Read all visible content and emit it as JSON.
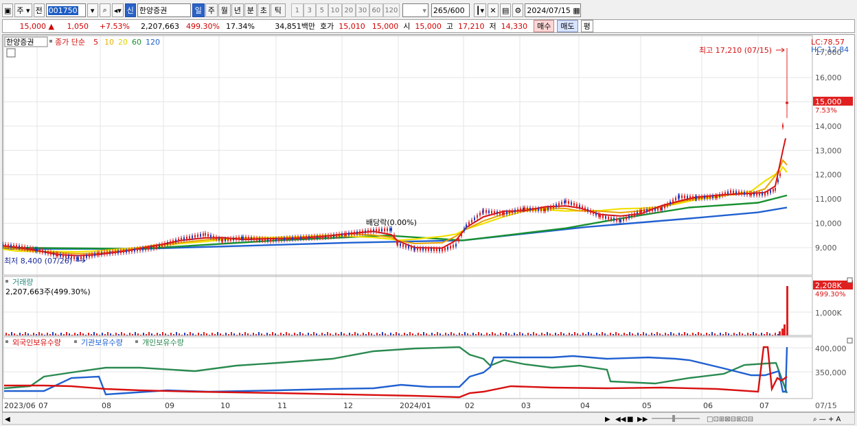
{
  "toolbar": {
    "market_type": "주",
    "prev_label": "전",
    "stock_code": "001750",
    "shin_badge": "신",
    "stock_name": "한양증권",
    "periods": [
      "일",
      "주",
      "월",
      "년",
      "분",
      "초",
      "틱"
    ],
    "active_period": "일",
    "numbers": [
      "1",
      "3",
      "5",
      "10",
      "20",
      "30",
      "60",
      "120"
    ],
    "count": "265",
    "count_max": "/600",
    "date": "2024/07/15"
  },
  "quote": {
    "price": "15,000",
    "change": "1,050",
    "change_pct": "+7.53%",
    "volume": "2,207,663",
    "volume_ratio": "499.30%",
    "turnover": "17.34%",
    "amount": "34,851백만",
    "hoga_label": "호가",
    "ask": "15,010",
    "bid": "15,000",
    "open_label": "시",
    "open": "15,000",
    "high_label": "고",
    "high": "17,210",
    "low_label": "저",
    "low": "14,330",
    "buy_label": "매수",
    "sell_label": "매도",
    "avg_label": "평"
  },
  "price_panel": {
    "stock_tag": "한양증권",
    "legend_title": "종가 단순",
    "ma_periods": [
      "5",
      "10",
      "20",
      "60",
      "120"
    ],
    "ma_colors": [
      "#d81010",
      "#e8b000",
      "#f0e000",
      "#189030",
      "#2060d0"
    ],
    "lc_label": "LC:78.57",
    "hc_label": "HC:-12.84",
    "high_annotation": "최고 17,210 (07/15)",
    "low_annotation": "최저 8,400 (07/26)",
    "dividend_annotation": "배당락(0.00%)",
    "price_tag": "15,000",
    "price_tag_pct": "7.53%",
    "y_ticks": [
      "16,000",
      "15,000",
      "14,000",
      "13,000",
      "12,000",
      "11,000",
      "10,000",
      "9,000"
    ],
    "top_tick_partial": "17,000"
  },
  "volume_panel": {
    "title": "거래량",
    "value_label": "2,207,663주(499.30%)",
    "tag": "2,208K",
    "tag_pct": "499.30%",
    "y_tick": "1,000K"
  },
  "holdings_panel": {
    "series_labels": [
      "외국인보유수량",
      "기관보유수량",
      "개인보유수량"
    ],
    "series_colors": [
      "#d81010",
      "#2060d0",
      "#2a8a50"
    ],
    "y_ticks": [
      "400,000",
      "350,000"
    ]
  },
  "x_axis": {
    "labels": [
      "2023/06",
      "07",
      "08",
      "09",
      "10",
      "11",
      "12",
      "2024/01",
      "02",
      "03",
      "04",
      "05",
      "06",
      "07"
    ],
    "last_label": "07/15"
  },
  "chart_data": {
    "type": "line",
    "price_series": [
      {
        "x": "2023/06",
        "y": 9100
      },
      {
        "x": "07",
        "y": 8600
      },
      {
        "x": "08",
        "y": 8800
      },
      {
        "x": "09",
        "y": 9500
      },
      {
        "x": "10",
        "y": 9300
      },
      {
        "x": "11",
        "y": 9400
      },
      {
        "x": "12",
        "y": 9600
      },
      {
        "x": "2024/01",
        "y": 8900
      },
      {
        "x": "02",
        "y": 10600
      },
      {
        "x": "03",
        "y": 10500
      },
      {
        "x": "04",
        "y": 10200
      },
      {
        "x": "05",
        "y": 10800
      },
      {
        "x": "06",
        "y": 11100
      },
      {
        "x": "07",
        "y": 11300
      },
      {
        "x": "07/15",
        "y": 15000
      }
    ],
    "high": 17210,
    "low": 8400,
    "ylim": [
      8200,
      17300
    ]
  }
}
